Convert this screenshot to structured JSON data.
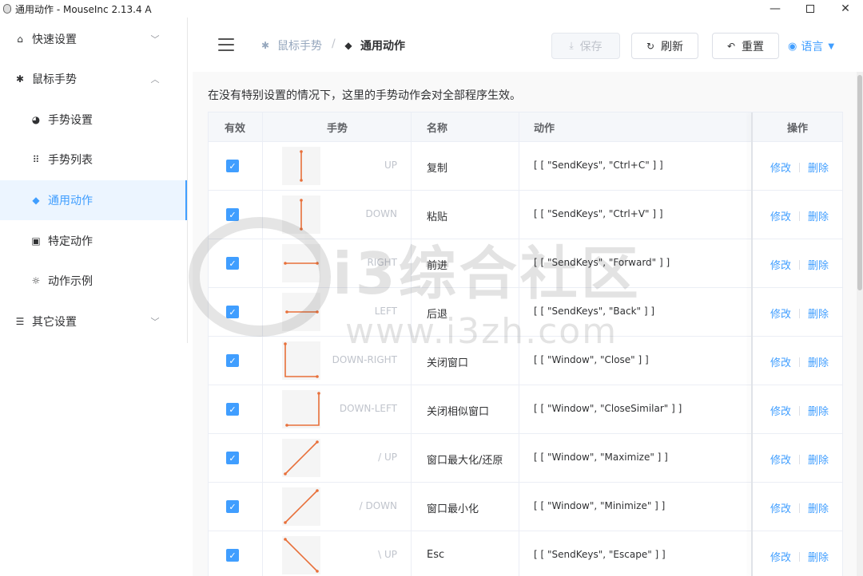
{
  "window": {
    "title": "通用动作 - MouseInc 2.13.4 A"
  },
  "sidebar": {
    "items": [
      {
        "label": "快速设置",
        "icon": "home-icon",
        "expanded": false
      },
      {
        "label": "鼠标手势",
        "icon": "gear-icon",
        "expanded": true
      },
      {
        "label": "手势设置",
        "icon": "palette-icon"
      },
      {
        "label": "手势列表",
        "icon": "grid-icon"
      },
      {
        "label": "通用动作",
        "icon": "cube-icon",
        "active": true
      },
      {
        "label": "特定动作",
        "icon": "briefcase-icon"
      },
      {
        "label": "动作示例",
        "icon": "sun-icon"
      },
      {
        "label": "其它设置",
        "icon": "sliders-icon",
        "expanded": false
      }
    ]
  },
  "header": {
    "breadcrumb": [
      "鼠标手势",
      "通用动作"
    ],
    "separator": "/",
    "buttons": {
      "save": "保存",
      "refresh": "刷新",
      "reset": "重置"
    },
    "language": "语言"
  },
  "main": {
    "description": "在没有特别设置的情况下，这里的手势动作会对全部程序生效。",
    "columns": {
      "enabled": "有效",
      "gesture": "手势",
      "name": "名称",
      "action": "动作",
      "ops": "操作"
    },
    "op_edit": "修改",
    "op_delete": "删除",
    "rows": [
      {
        "gesture": "UP",
        "name": "复制",
        "action": "[ [ \"SendKeys\", \"Ctrl+C\" ] ]"
      },
      {
        "gesture": "DOWN",
        "name": "粘贴",
        "action": "[ [ \"SendKeys\", \"Ctrl+V\" ] ]"
      },
      {
        "gesture": "RIGHT",
        "name": "前进",
        "action": "[ [ \"SendKeys\", \"Forward\" ] ]"
      },
      {
        "gesture": "LEFT",
        "name": "后退",
        "action": "[ [ \"SendKeys\", \"Back\" ] ]"
      },
      {
        "gesture": "DOWN-RIGHT",
        "name": "关闭窗口",
        "action": "[ [ \"Window\", \"Close\" ] ]"
      },
      {
        "gesture": "DOWN-LEFT",
        "name": "关闭相似窗口",
        "action": "[ [ \"Window\", \"CloseSimilar\" ] ]"
      },
      {
        "gesture": "/ UP",
        "name": "窗口最大化/还原",
        "action": "[ [ \"Window\", \"Maximize\" ] ]"
      },
      {
        "gesture": "/ DOWN",
        "name": "窗口最小化",
        "action": "[ [ \"Window\", \"Minimize\" ] ]"
      },
      {
        "gesture": "\\ UP",
        "name": "Esc",
        "action": "[ [ \"SendKeys\", \"Escape\" ] ]"
      }
    ]
  },
  "colors": {
    "accent": "#409eff",
    "gesture_stroke": "#e8703a"
  },
  "watermark": {
    "text": "i3综合社区",
    "url": "www.i3zh.com"
  }
}
